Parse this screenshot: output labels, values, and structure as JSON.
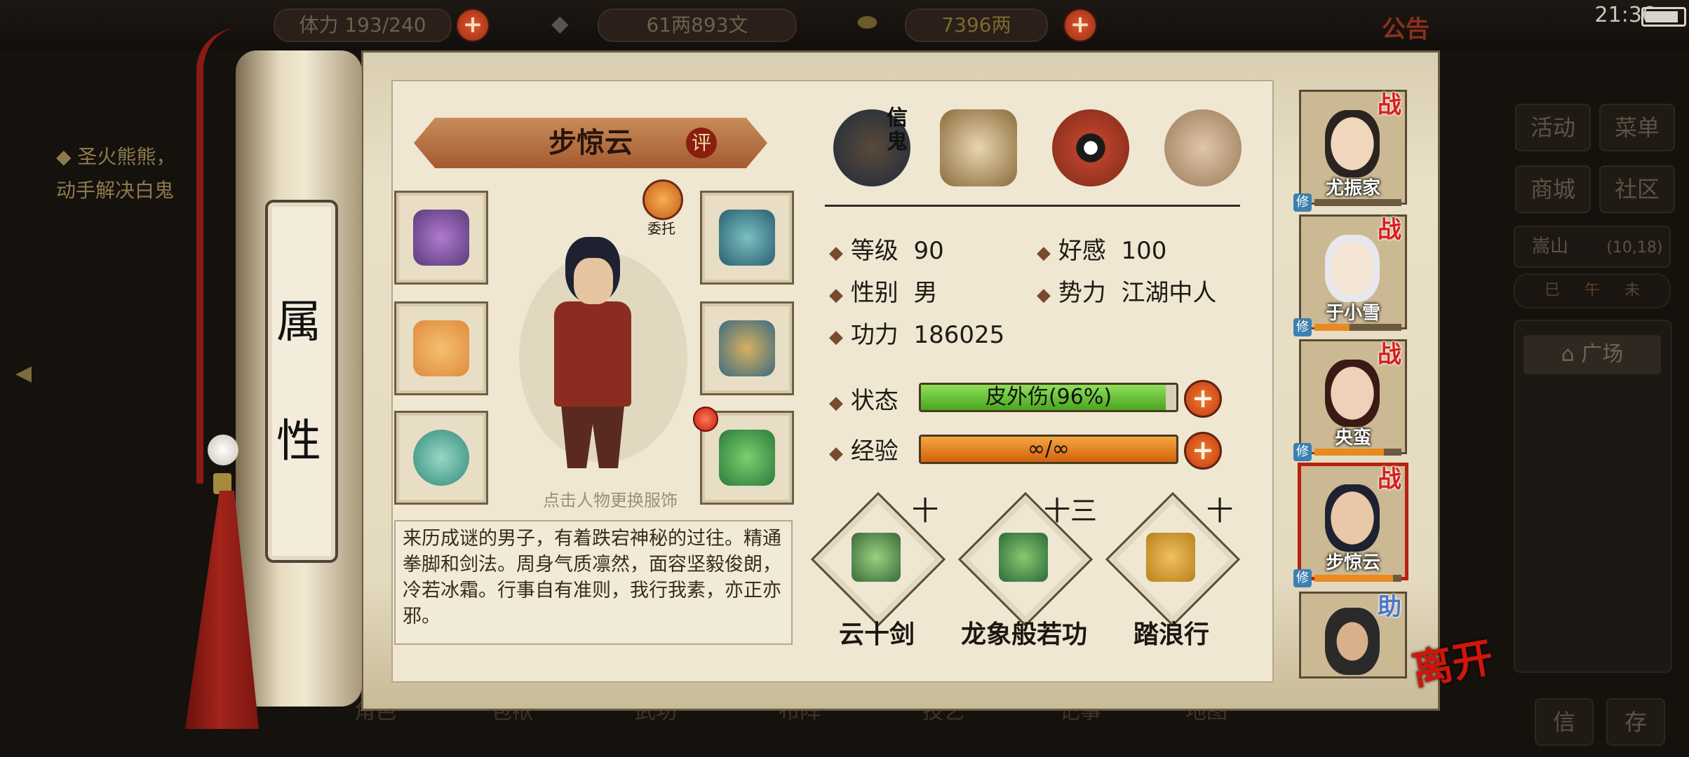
{
  "status_bar": {
    "clock": "21:36"
  },
  "top_bar": {
    "stamina_label": "体力",
    "stamina_value": "193/240",
    "silver_value": "61两893文",
    "gold_value": "7396两",
    "notice_label": "公告"
  },
  "left_panel": {
    "quest_line1": "◆ 圣火熊熊，",
    "quest_line2": "动手解决白鬼"
  },
  "right_panel": {
    "buttons": [
      "活动",
      "菜单",
      "商城",
      "社区"
    ],
    "location_name": "嵩山",
    "location_coords": "(10,18)",
    "time_chars": [
      "巳",
      "午",
      "未"
    ],
    "chat_channel": "广场",
    "bottom_buttons": [
      "信",
      "存"
    ]
  },
  "bottom_menu": [
    "角色",
    "包袱",
    "武功",
    "布阵",
    "技艺",
    "记事",
    "地图"
  ],
  "scroll_label": [
    "属",
    "性"
  ],
  "character": {
    "name": "步惊云",
    "rate_badge": "评",
    "delegate_label": "委托",
    "change_outfit_hint": "点击人物更换服饰",
    "description": "来历成谜的男子，有着跌宕神秘的过往。精通拳脚和剑法。周身气质凛然，面容坚毅俊朗，冷若冰霜。行事自有准则，我行我素，亦正亦邪。",
    "title_badge": "信鬼"
  },
  "equipment": {
    "left": [
      "gauntlet-icon",
      "sword-icon",
      "ring-icon"
    ],
    "right": [
      "helmet-icon",
      "armor-icon",
      "bell-icon"
    ]
  },
  "stats": {
    "level_label": "等级",
    "level_value": "90",
    "favor_label": "好感",
    "favor_value": "100",
    "gender_label": "性别",
    "gender_value": "男",
    "faction_label": "势力",
    "faction_value": "江湖中人",
    "power_label": "功力",
    "power_value": "186025",
    "status_label": "状态",
    "status_text": "皮外伤(96%)",
    "status_fraction": 0.96,
    "exp_label": "经验",
    "exp_text": "∞/∞",
    "exp_fraction": 1.0
  },
  "skills": [
    {
      "name": "云十剑",
      "level": "十"
    },
    {
      "name": "龙象般若功",
      "level": "十三"
    },
    {
      "name": "踏浪行",
      "level": "十"
    }
  ],
  "roster": [
    {
      "name": "尤振家",
      "badge": "战",
      "xiu": "修"
    },
    {
      "name": "于小雪",
      "badge": "战",
      "xiu": "修"
    },
    {
      "name": "央蛮",
      "badge": "战",
      "xiu": "修"
    },
    {
      "name": "步惊云",
      "badge": "战",
      "xiu": "修"
    },
    {
      "name": "",
      "badge": "助",
      "xiu": ""
    }
  ],
  "leave_label": "离开",
  "colors": {
    "accent_red": "#b8200f",
    "status_bar_green": "#5fbf2a",
    "exp_bar_orange": "#e07a14"
  }
}
